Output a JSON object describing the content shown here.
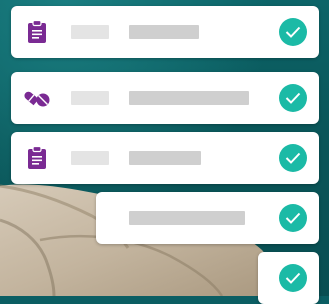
{
  "colors": {
    "background": "#0b5e63",
    "card": "#ffffff",
    "icon_purple": "#7a2a93",
    "check_teal": "#1bbaa6",
    "placeholder_light": "#e4e4e4",
    "placeholder_mid": "#cfcfcf"
  },
  "checklist": {
    "items": [
      {
        "icon": "clipboard-icon",
        "status": "completed",
        "status_icon": "checkmark-icon"
      },
      {
        "icon": "pills-icon",
        "status": "completed",
        "status_icon": "checkmark-icon"
      },
      {
        "icon": "clipboard-icon",
        "status": "completed",
        "status_icon": "checkmark-icon"
      },
      {
        "icon": "",
        "status": "completed",
        "status_icon": "checkmark-icon"
      },
      {
        "icon": "",
        "status": "completed",
        "status_icon": "checkmark-icon"
      }
    ]
  }
}
